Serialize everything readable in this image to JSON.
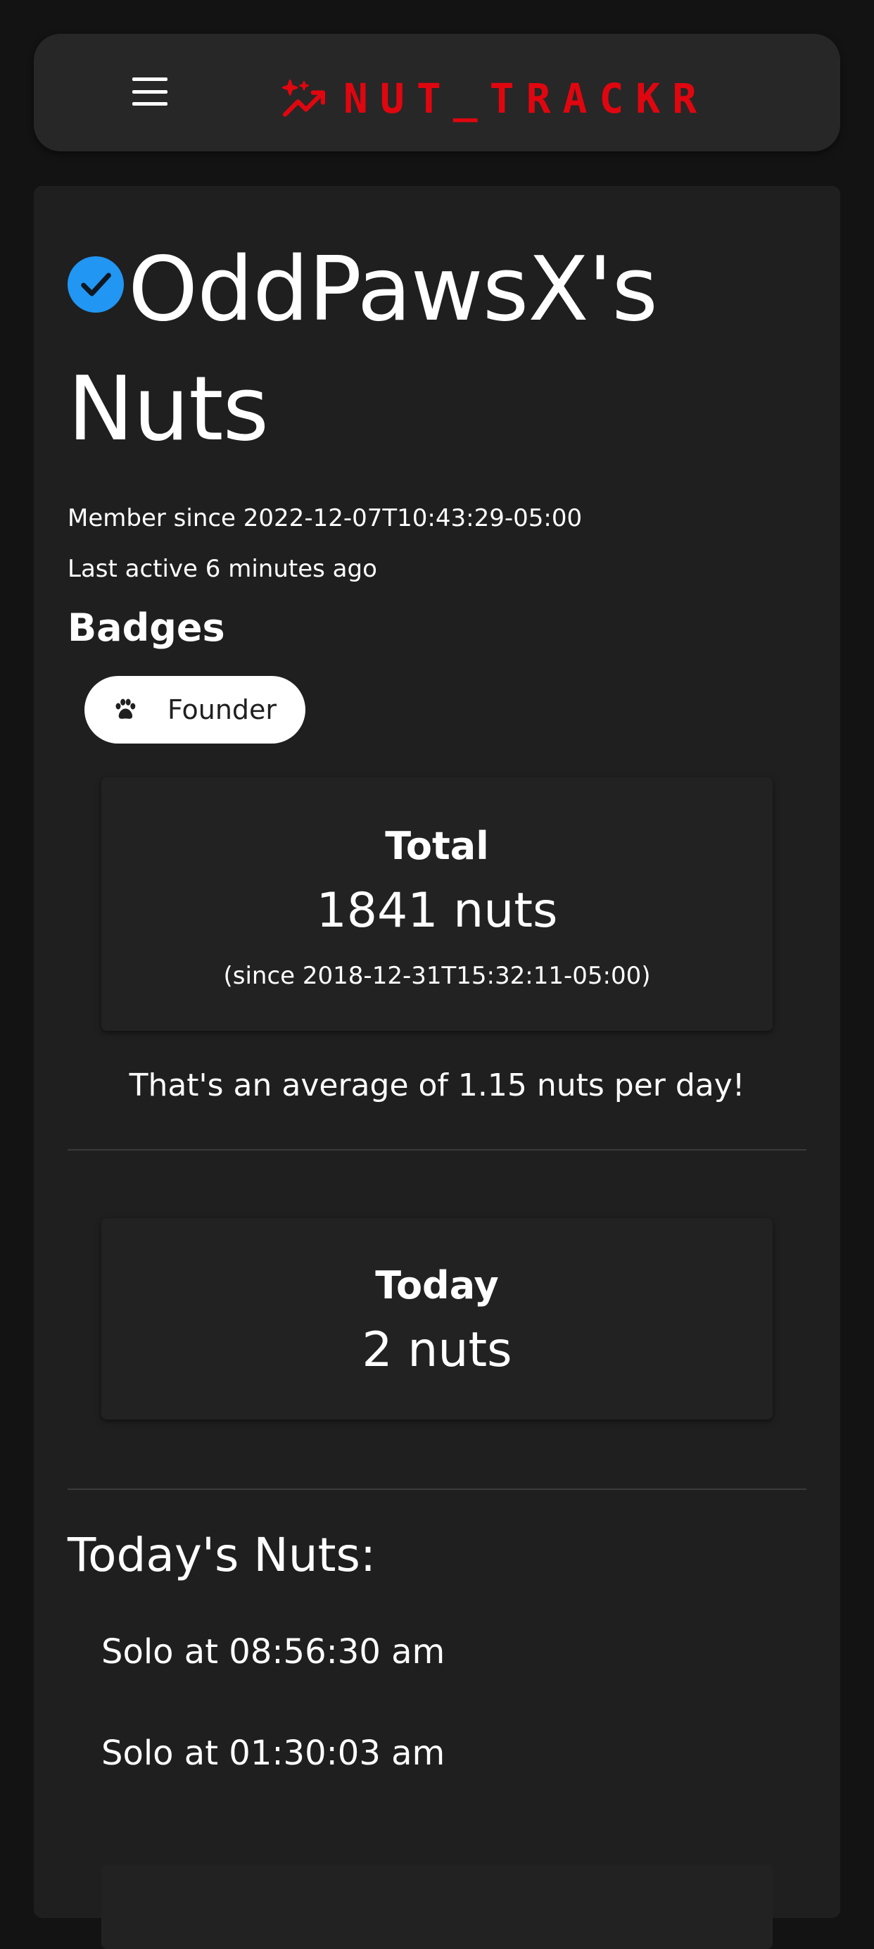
{
  "header": {
    "menu_icon": "hamburger-menu-icon",
    "brand_icon": "sparkle-chart-icon",
    "brand_text": "NUT_TRACKR",
    "brand_color": "#e0060f"
  },
  "profile": {
    "verified_icon": "verified-check-icon",
    "verified_color": "#2196f3",
    "title": "OddPawsX's Nuts",
    "member_since": "Member since 2022-12-07T10:43:29-05:00",
    "last_active": "Last active 6 minutes ago"
  },
  "badges": {
    "heading": "Badges",
    "items": [
      {
        "icon": "paw-icon",
        "label": "Founder"
      }
    ]
  },
  "total": {
    "label": "Total",
    "value": "1841 nuts",
    "since": "(since 2018-12-31T15:32:11-05:00)",
    "average": "That's an average of 1.15 nuts per day!"
  },
  "today": {
    "label": "Today",
    "value": "2 nuts",
    "heading": "Today's Nuts:",
    "items": [
      "Solo at 08:56:30 am",
      "Solo at 01:30:03 am"
    ]
  }
}
